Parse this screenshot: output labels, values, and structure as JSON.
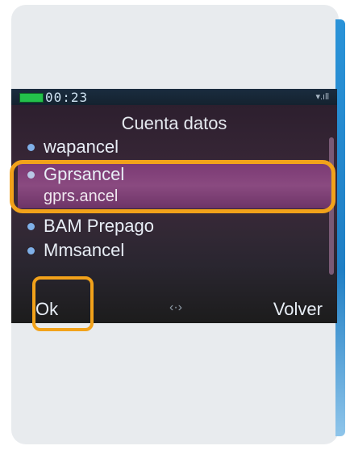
{
  "status": {
    "time": "00:23",
    "signal": "▾.ıll"
  },
  "screen_title": "Cuenta datos",
  "items": [
    {
      "label": "wapancel"
    },
    {
      "label": "Gprsancel",
      "sub": "gprs.ancel",
      "selected": true
    },
    {
      "label": "BAM Prepago"
    },
    {
      "label": "Mmsancel"
    }
  ],
  "softkeys": {
    "left": "Ok",
    "center": "‹·›",
    "right": "Volver"
  },
  "colors": {
    "highlight": "#f2a21a",
    "selection": "#7b3a74",
    "accent": "#1f7fc5"
  }
}
